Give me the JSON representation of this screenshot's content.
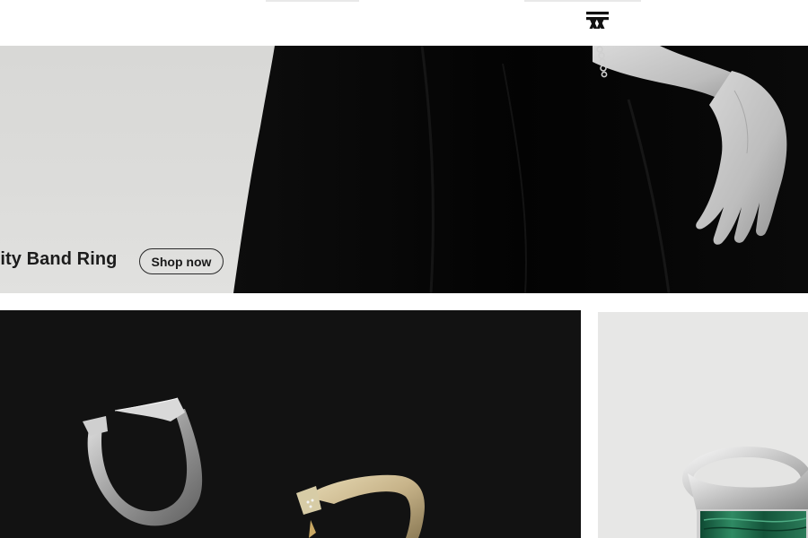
{
  "brand": {
    "logo_icon": "brand-monogram-icon"
  },
  "hero": {
    "title": "nity Band Ring",
    "cta_label": "Shop now"
  },
  "colors": {
    "background": "#ffffff",
    "hero_light": "#dcdcda",
    "hero_dark": "#050505",
    "tile_dark": "#121212",
    "tile_light": "#e7e7e6",
    "stone_green": "#1f6b4c"
  }
}
